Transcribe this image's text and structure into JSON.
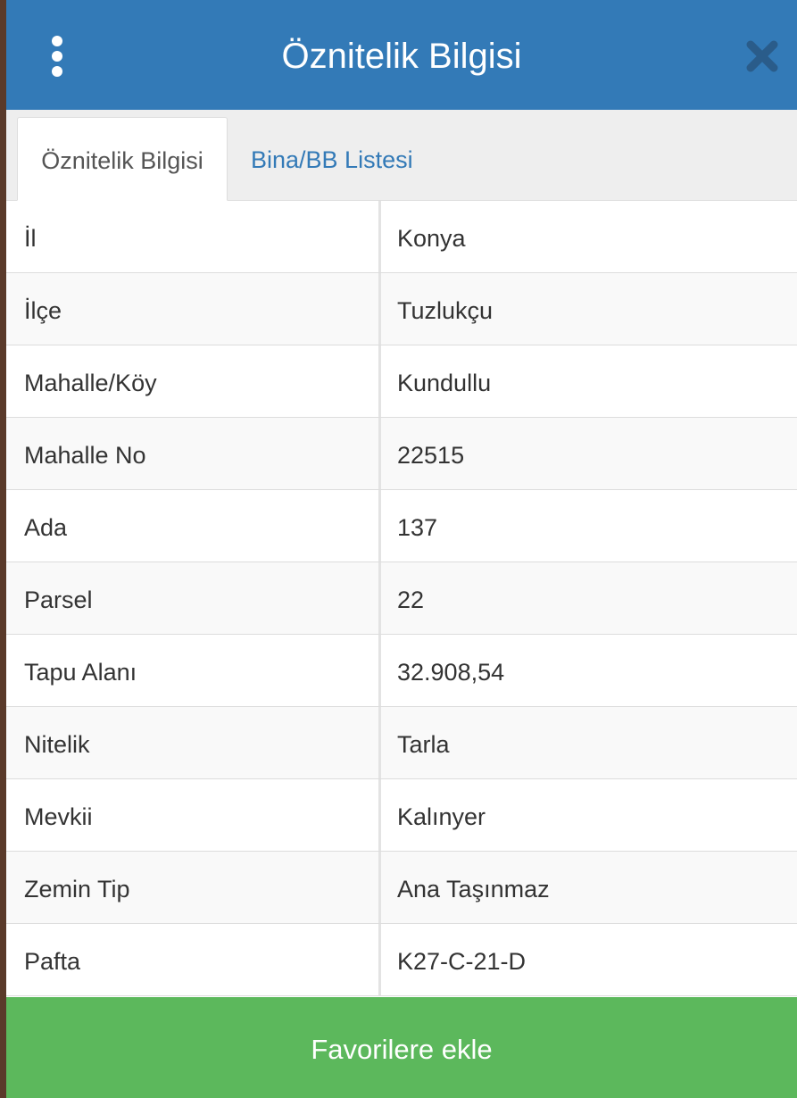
{
  "header": {
    "title": "Öznitelik Bilgisi",
    "menu_icon": "kebab-menu-icon",
    "close_icon": "close-icon"
  },
  "tabs": [
    {
      "label": "Öznitelik Bilgisi",
      "active": true
    },
    {
      "label": "Bina/BB Listesi",
      "active": false
    }
  ],
  "attributes": [
    {
      "key": "İl",
      "value": "Konya"
    },
    {
      "key": "İlçe",
      "value": "Tuzlukçu"
    },
    {
      "key": "Mahalle/Köy",
      "value": "Kundullu"
    },
    {
      "key": "Mahalle No",
      "value": "22515"
    },
    {
      "key": "Ada",
      "value": "137"
    },
    {
      "key": "Parsel",
      "value": "22"
    },
    {
      "key": "Tapu Alanı",
      "value": "32.908,54"
    },
    {
      "key": "Nitelik",
      "value": "Tarla"
    },
    {
      "key": "Mevkii",
      "value": "Kalınyer"
    },
    {
      "key": "Zemin Tip",
      "value": "Ana Taşınmaz"
    },
    {
      "key": "Pafta",
      "value": "K27-C-21-D"
    }
  ],
  "footer": {
    "favorite_label": "Favorilere ekle"
  },
  "colors": {
    "header": "#337ab7",
    "footer": "#5cb85c",
    "link": "#337ab7"
  }
}
